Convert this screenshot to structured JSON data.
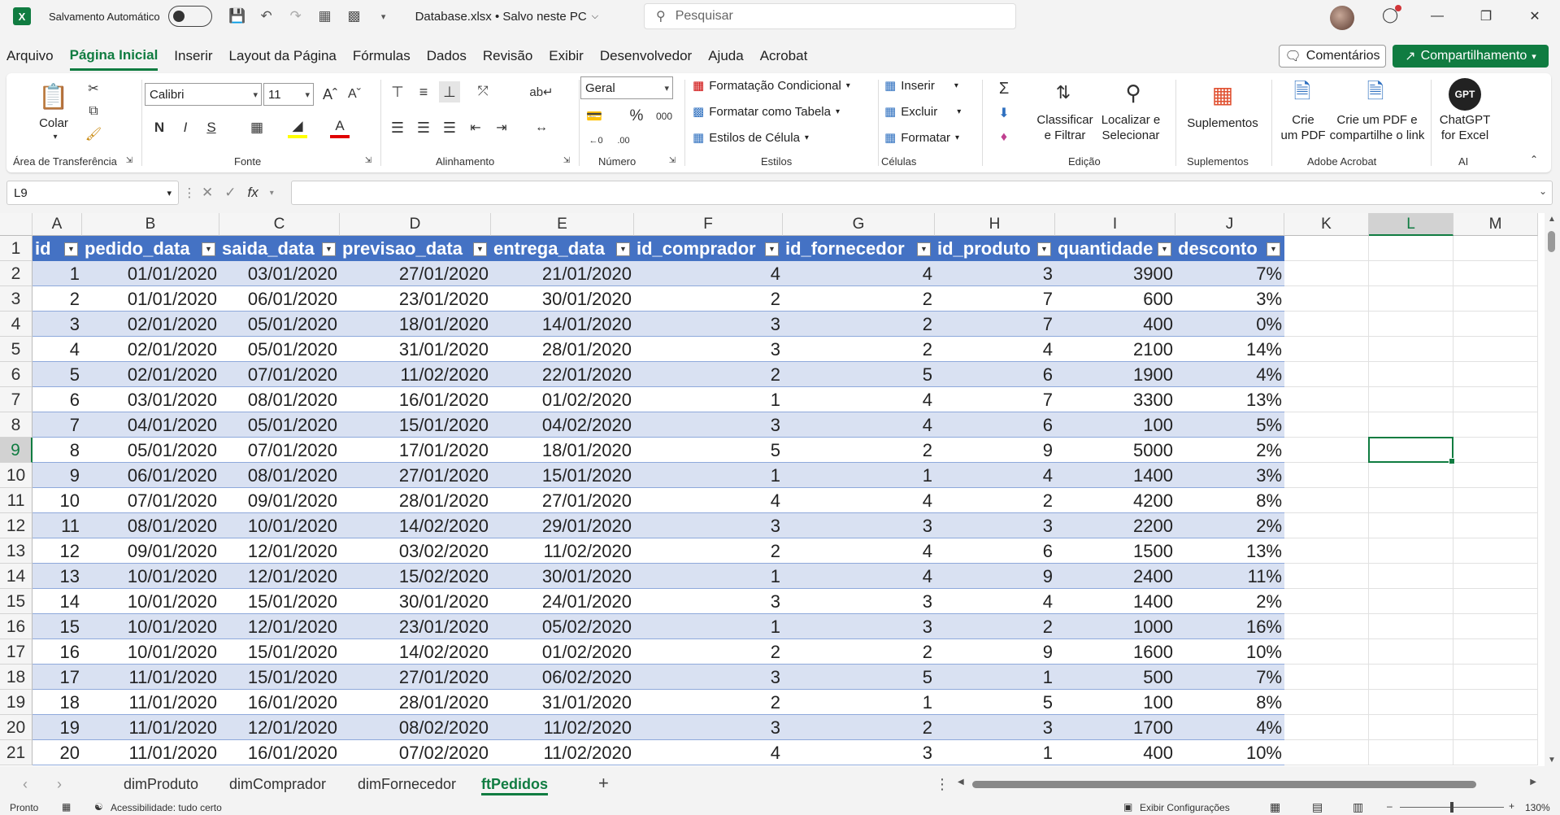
{
  "titlebar": {
    "autosave_label": "Salvamento Automático",
    "filename": "Database.xlsx • Salvo neste PC",
    "search_placeholder": "Pesquisar"
  },
  "tabs": [
    "Arquivo",
    "Página Inicial",
    "Inserir",
    "Layout da Página",
    "Fórmulas",
    "Dados",
    "Revisão",
    "Exibir",
    "Desenvolvedor",
    "Ajuda",
    "Acrobat"
  ],
  "active_tab": "Página Inicial",
  "actions": {
    "comments": "Comentários",
    "share": "Compartilhamento"
  },
  "ribbon": {
    "clipboard": {
      "paste": "Colar",
      "label": "Área de Transferência"
    },
    "font": {
      "name": "Calibri",
      "size": "11",
      "label": "Fonte",
      "bold": "N",
      "italic": "I",
      "underline": "S"
    },
    "alignment": {
      "label": "Alinhamento"
    },
    "number": {
      "format": "Geral",
      "percent": "%",
      "thousands": "000",
      "label": "Número"
    },
    "styles": {
      "conditional": "Formatação Condicional",
      "as_table": "Formatar como Tabela",
      "cell_styles": "Estilos de Célula",
      "label": "Estilos"
    },
    "cells": {
      "insert": "Inserir",
      "delete": "Excluir",
      "format": "Formatar",
      "label": "Células"
    },
    "editing": {
      "sort_line1": "Classificar",
      "sort_line2": "e Filtrar",
      "find_line1": "Localizar e",
      "find_line2": "Selecionar",
      "label": "Edição"
    },
    "addins": {
      "button": "Suplementos",
      "label": "Suplementos"
    },
    "acrobat": {
      "create_line1": "Crie",
      "create_line2": "um PDF",
      "share_line1": "Crie um PDF e",
      "share_line2": "compartilhe o link",
      "label": "Adobe Acrobat"
    },
    "ai": {
      "badge": "GPT",
      "line1": "ChatGPT",
      "line2": "for Excel",
      "label": "AI"
    }
  },
  "formula_bar": {
    "name_box": "L9",
    "fx": "fx",
    "formula": ""
  },
  "grid": {
    "columns": [
      "A",
      "B",
      "C",
      "D",
      "E",
      "F",
      "G",
      "H",
      "I",
      "J",
      "K",
      "L",
      "M"
    ],
    "selected_column": "L",
    "selected_row": 9,
    "row_numbers": [
      1,
      2,
      3,
      4,
      5,
      6,
      7,
      8,
      9,
      10,
      11,
      12,
      13,
      14,
      15,
      16,
      17,
      18,
      19,
      20,
      21
    ],
    "headers": [
      "id",
      "pedido_data",
      "saida_data",
      "previsao_data",
      "entrega_data",
      "id_comprador",
      "id_fornecedor",
      "id_produto",
      "quantidade",
      "desconto"
    ],
    "rows": [
      [
        "1",
        "01/01/2020",
        "03/01/2020",
        "27/01/2020",
        "21/01/2020",
        "4",
        "4",
        "3",
        "3900",
        "7%"
      ],
      [
        "2",
        "01/01/2020",
        "06/01/2020",
        "23/01/2020",
        "30/01/2020",
        "2",
        "2",
        "7",
        "600",
        "3%"
      ],
      [
        "3",
        "02/01/2020",
        "05/01/2020",
        "18/01/2020",
        "14/01/2020",
        "3",
        "2",
        "7",
        "400",
        "0%"
      ],
      [
        "4",
        "02/01/2020",
        "05/01/2020",
        "31/01/2020",
        "28/01/2020",
        "3",
        "2",
        "4",
        "2100",
        "14%"
      ],
      [
        "5",
        "02/01/2020",
        "07/01/2020",
        "11/02/2020",
        "22/01/2020",
        "2",
        "5",
        "6",
        "1900",
        "4%"
      ],
      [
        "6",
        "03/01/2020",
        "08/01/2020",
        "16/01/2020",
        "01/02/2020",
        "1",
        "4",
        "7",
        "3300",
        "13%"
      ],
      [
        "7",
        "04/01/2020",
        "05/01/2020",
        "15/01/2020",
        "04/02/2020",
        "3",
        "4",
        "6",
        "100",
        "5%"
      ],
      [
        "8",
        "05/01/2020",
        "07/01/2020",
        "17/01/2020",
        "18/01/2020",
        "5",
        "2",
        "9",
        "5000",
        "2%"
      ],
      [
        "9",
        "06/01/2020",
        "08/01/2020",
        "27/01/2020",
        "15/01/2020",
        "1",
        "1",
        "4",
        "1400",
        "3%"
      ],
      [
        "10",
        "07/01/2020",
        "09/01/2020",
        "28/01/2020",
        "27/01/2020",
        "4",
        "4",
        "2",
        "4200",
        "8%"
      ],
      [
        "11",
        "08/01/2020",
        "10/01/2020",
        "14/02/2020",
        "29/01/2020",
        "3",
        "3",
        "3",
        "2200",
        "2%"
      ],
      [
        "12",
        "09/01/2020",
        "12/01/2020",
        "03/02/2020",
        "11/02/2020",
        "2",
        "4",
        "6",
        "1500",
        "13%"
      ],
      [
        "13",
        "10/01/2020",
        "12/01/2020",
        "15/02/2020",
        "30/01/2020",
        "1",
        "4",
        "9",
        "2400",
        "11%"
      ],
      [
        "14",
        "10/01/2020",
        "15/01/2020",
        "30/01/2020",
        "24/01/2020",
        "3",
        "3",
        "4",
        "1400",
        "2%"
      ],
      [
        "15",
        "10/01/2020",
        "12/01/2020",
        "23/01/2020",
        "05/02/2020",
        "1",
        "3",
        "2",
        "1000",
        "16%"
      ],
      [
        "16",
        "10/01/2020",
        "15/01/2020",
        "14/02/2020",
        "01/02/2020",
        "2",
        "2",
        "9",
        "1600",
        "10%"
      ],
      [
        "17",
        "11/01/2020",
        "15/01/2020",
        "27/01/2020",
        "06/02/2020",
        "3",
        "5",
        "1",
        "500",
        "7%"
      ],
      [
        "18",
        "11/01/2020",
        "16/01/2020",
        "28/01/2020",
        "31/01/2020",
        "2",
        "1",
        "5",
        "100",
        "8%"
      ],
      [
        "19",
        "11/01/2020",
        "12/01/2020",
        "08/02/2020",
        "11/02/2020",
        "3",
        "2",
        "3",
        "1700",
        "4%"
      ],
      [
        "20",
        "11/01/2020",
        "16/01/2020",
        "07/02/2020",
        "11/02/2020",
        "4",
        "3",
        "1",
        "400",
        "10%"
      ]
    ]
  },
  "sheets": [
    "dimProduto",
    "dimComprador",
    "dimFornecedor",
    "ftPedidos"
  ],
  "active_sheet": "ftPedidos",
  "statusbar": {
    "ready": "Pronto",
    "accessibility": "Acessibilidade: tudo certo",
    "display_settings": "Exibir Configurações",
    "zoom": "130%"
  },
  "colors": {
    "excel_green": "#107c41",
    "table_header": "#4472c4",
    "band": "#d9e1f2"
  }
}
